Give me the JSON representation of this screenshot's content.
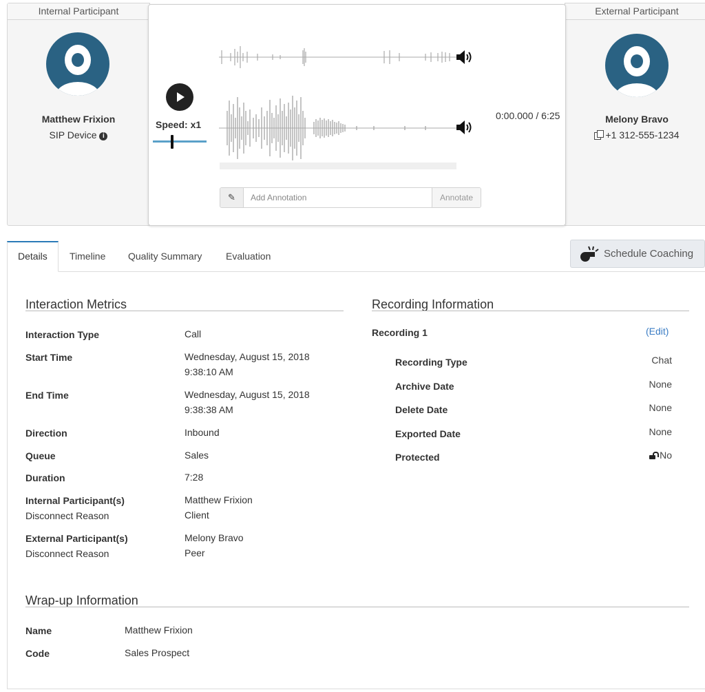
{
  "internal_participant": {
    "header": "Internal Participant",
    "name": "Matthew Frixion",
    "device": "SIP Device"
  },
  "external_participant": {
    "header": "External Participant",
    "name": "Melony Bravo",
    "phone": "+1 312-555-1234"
  },
  "player": {
    "speed_label": "Speed: x1",
    "time": "0:00.000 / 6:25",
    "playback_progress": 0,
    "annotation_placeholder": "Add Annotation",
    "annotate_button": "Annotate"
  },
  "tabs": [
    {
      "label": "Details",
      "active": true
    },
    {
      "label": "Timeline",
      "active": false
    },
    {
      "label": "Quality Summary",
      "active": false
    },
    {
      "label": "Evaluation",
      "active": false
    }
  ],
  "schedule_coaching_button": "Schedule Coaching",
  "interaction_metrics": {
    "title": "Interaction Metrics",
    "rows": [
      {
        "label": "Interaction Type",
        "value": "Call"
      },
      {
        "label": "Start Time",
        "value": "Wednesday, August 15, 2018",
        "value2": "9:38:10 AM"
      },
      {
        "label": "End Time",
        "value": "Wednesday, August 15, 2018",
        "value2": "9:38:38 AM"
      },
      {
        "label": "Direction",
        "value": "Inbound"
      },
      {
        "label": "Queue",
        "value": "Sales"
      },
      {
        "label": "Duration",
        "value": "7:28"
      },
      {
        "label": "Internal Participant(s)",
        "sublabel": "Disconnect Reason",
        "value": "Matthew Frixion",
        "value2": "Client"
      },
      {
        "label": "External Participant(s)",
        "sublabel": "Disconnect Reason",
        "value": "Melony Bravo",
        "value2": "Peer"
      }
    ]
  },
  "recording_information": {
    "title": "Recording Information",
    "recording_name": "Recording 1",
    "edit_link": "(Edit)",
    "rows": [
      {
        "label": "Recording Type",
        "value": "Chat"
      },
      {
        "label": "Archive Date",
        "value": "None"
      },
      {
        "label": "Delete Date",
        "value": "None"
      },
      {
        "label": "Exported Date",
        "value": "None"
      },
      {
        "label": "Protected",
        "value": "No"
      }
    ]
  },
  "wrapup_information": {
    "title": "Wrap-up Information",
    "rows": [
      {
        "label": "Name",
        "value": "Matthew Frixion"
      },
      {
        "label": "Code",
        "value": "Sales Prospect"
      }
    ]
  },
  "colors": {
    "avatar": "#2a6283",
    "accent_link": "#3a7cc4",
    "speed_track": "#5aa0c8",
    "waveform": "#aaaaaa"
  }
}
